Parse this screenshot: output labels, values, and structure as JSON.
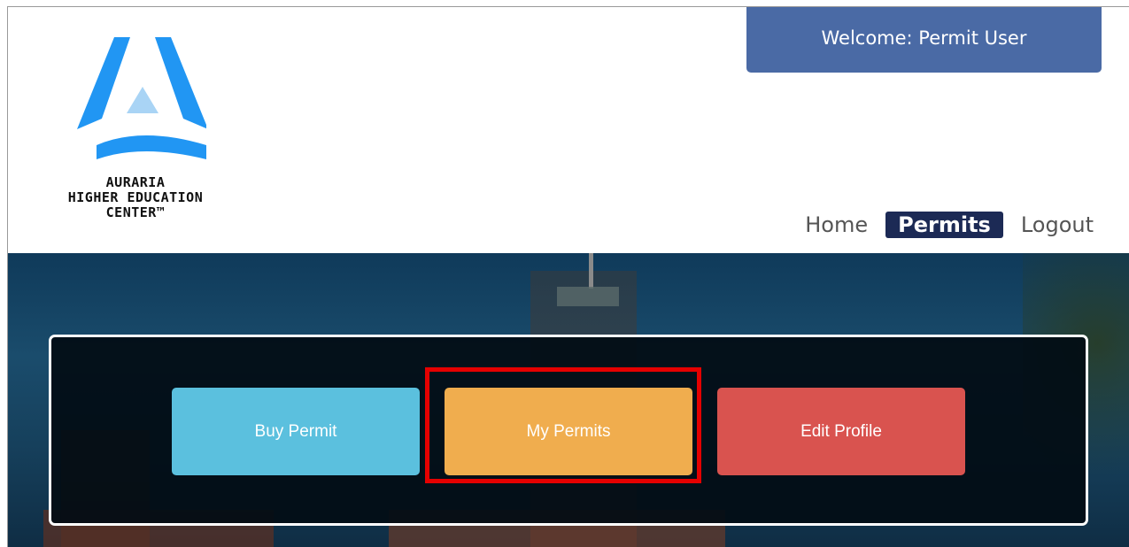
{
  "header": {
    "logo": {
      "line1": "AURARIA",
      "line2": "HIGHER EDUCATION",
      "line3": "CENTER™",
      "icon": "auraria-triangle-logo",
      "colors": {
        "primary": "#2196f3",
        "secondary": "#a9d4f5"
      }
    },
    "welcome": {
      "label": "Welcome:  Permit User",
      "background": "#4a6aa5"
    },
    "nav": {
      "items": [
        {
          "label": "Home",
          "active": false
        },
        {
          "label": "Permits",
          "active": true
        },
        {
          "label": "Logout",
          "active": false
        }
      ],
      "active_background": "#1c2a55"
    }
  },
  "main": {
    "actions": [
      {
        "label": "Buy Permit",
        "color": "#5bc0de"
      },
      {
        "label": "My Permits",
        "color": "#f0ad4e",
        "highlighted": true
      },
      {
        "label": "Edit Profile",
        "color": "#d9534f"
      }
    ],
    "highlight_color": "#e50000"
  }
}
